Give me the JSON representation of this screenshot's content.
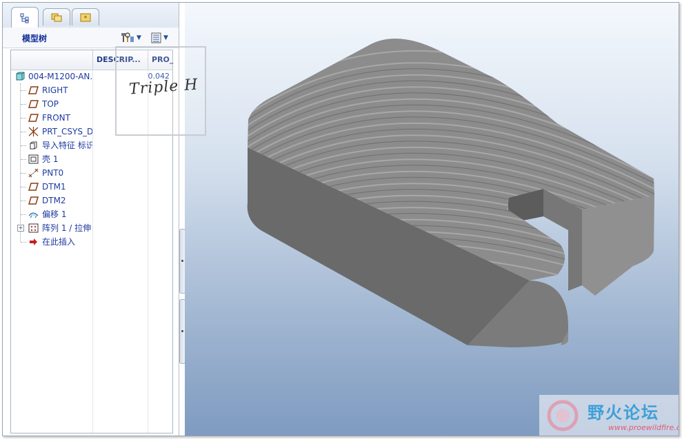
{
  "panel": {
    "title": "模型树",
    "tabs": [
      {
        "name": "model-tree-tab",
        "active": true
      },
      {
        "name": "folder-browser-tab",
        "active": false
      },
      {
        "name": "favorites-tab",
        "active": false
      }
    ],
    "toolbar": {
      "settings_icon": "tools-icon",
      "show_icon": "list-icon"
    }
  },
  "tree": {
    "columns": [
      "DESCRIP...",
      "PRO_"
    ],
    "rows": [
      {
        "label": "004-M1200-AN.",
        "value": "0.042",
        "icon": "part-icon"
      },
      {
        "label": "RIGHT",
        "icon": "datum-plane-icon"
      },
      {
        "label": "TOP",
        "icon": "datum-plane-icon"
      },
      {
        "label": "FRONT",
        "icon": "datum-plane-icon"
      },
      {
        "label": "PRT_CSYS_D",
        "icon": "coordinate-system-icon"
      },
      {
        "label": "导入特征 标识",
        "icon": "import-feature-icon"
      },
      {
        "label": "壳 1",
        "icon": "shell-icon"
      },
      {
        "label": "PNT0",
        "icon": "datum-point-icon"
      },
      {
        "label": "DTM1",
        "icon": "datum-plane-icon"
      },
      {
        "label": "DTM2",
        "icon": "datum-plane-icon"
      },
      {
        "label": "偏移 1",
        "icon": "offset-icon"
      },
      {
        "label": "阵列 1 / 拉伸",
        "icon": "pattern-icon",
        "expandable": true
      },
      {
        "label": "在此插入",
        "icon": "insert-here-arrow-icon"
      }
    ]
  },
  "watermark": {
    "text": "Triple H"
  },
  "logo": {
    "name": "野火论坛",
    "url": "www.proewildfire.cn"
  },
  "colors": {
    "tree_text": "#1e3aa0",
    "model_gray": "#8a8a8a",
    "logo_blue": "#3f9fd8"
  }
}
